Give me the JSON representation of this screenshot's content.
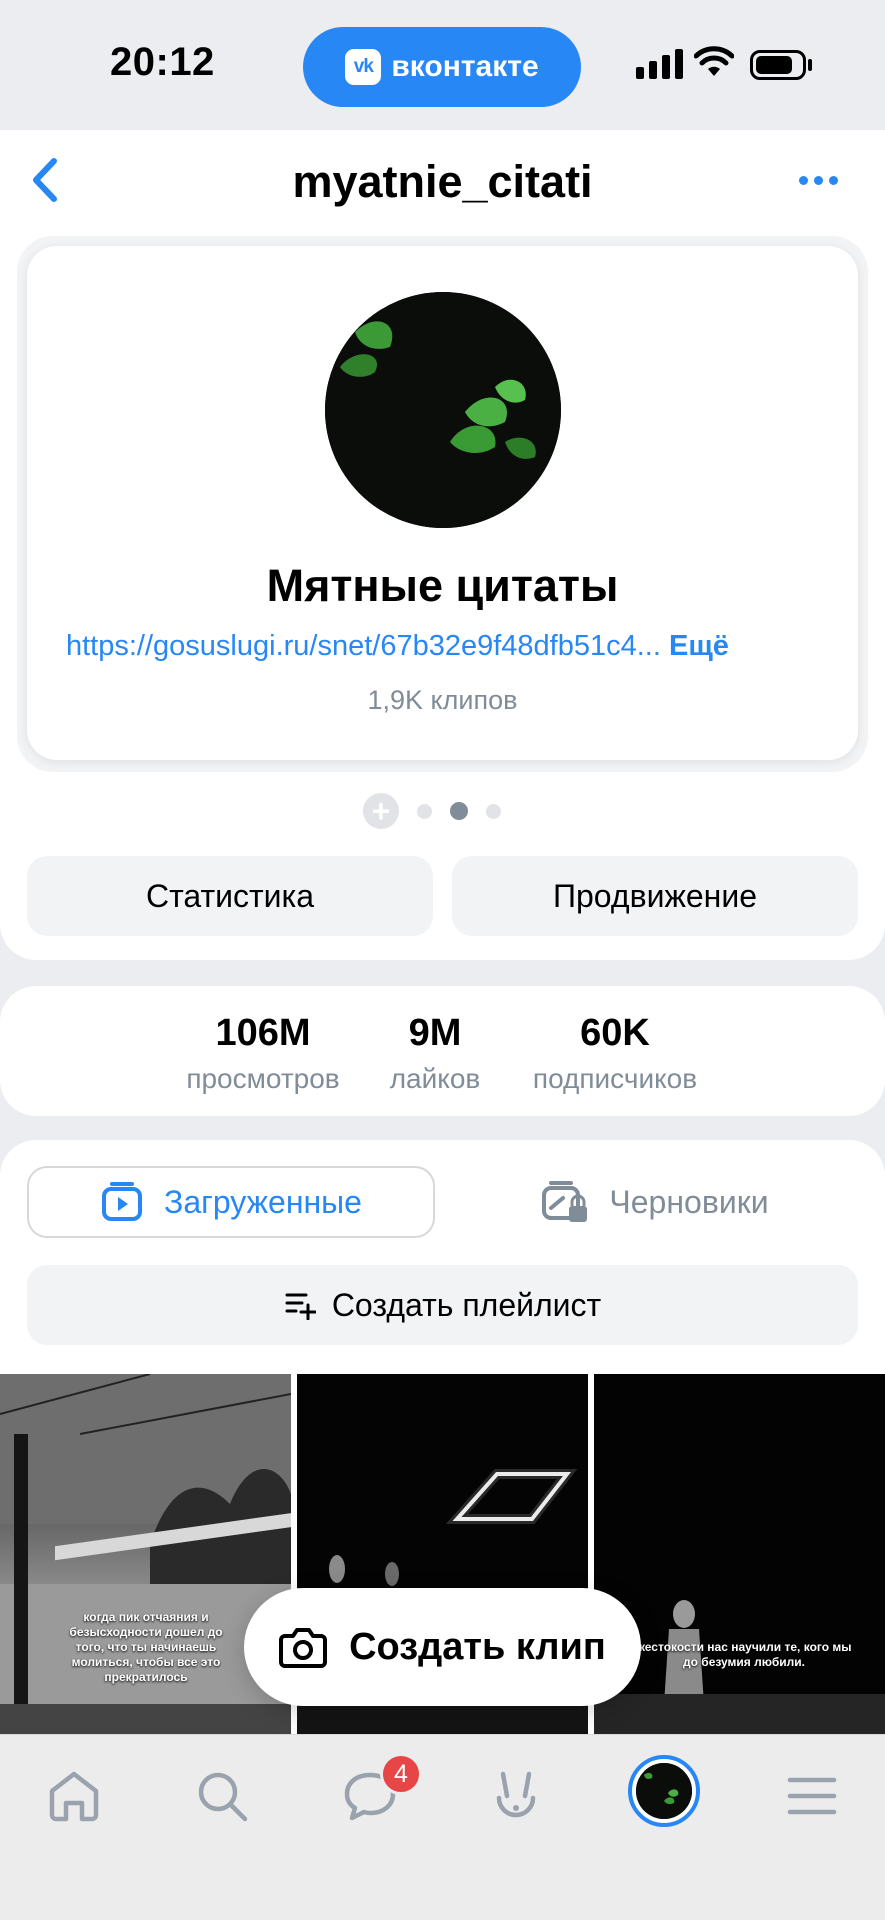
{
  "status_bar": {
    "time": "20:12",
    "app_pill_label": "вконтакте",
    "app_logo_text": "vk"
  },
  "header": {
    "title": "myatnie_citati"
  },
  "profile": {
    "name": "Мятные цитаты",
    "link": "https://gosuslugi.ru/snet/67b32e9f48dfb51c4...",
    "link_more": "Ещё",
    "clips_count": "1,9K клипов",
    "add_symbol": "+"
  },
  "actions": {
    "stats_label": "Статистика",
    "promo_label": "Продвижение"
  },
  "stats": [
    {
      "value": "106M",
      "label": "просмотров"
    },
    {
      "value": "9M",
      "label": "лайков"
    },
    {
      "value": "60K",
      "label": "подписчиков"
    }
  ],
  "tabs": {
    "uploaded_label": "Загруженные",
    "drafts_label": "Черновики"
  },
  "playlist_label": "Создать плейлист",
  "thumbnails": [
    {
      "caption": "когда пик отчаяния и безысходности дошел до того, что ты начинаешь молиться, чтобы все это прекратилось"
    },
    {
      "caption": ""
    },
    {
      "caption": "жестокости нас научили те, кого мы до безумия любили."
    }
  ],
  "create_clip_label": "Создать клип",
  "tabbar": {
    "messages_badge": "4"
  },
  "colors": {
    "accent": "#2787f5",
    "secondary_text": "#818c99",
    "badge": "#e64646",
    "background": "#ebedf0"
  },
  "icons": [
    "back-arrow-icon",
    "more-icon",
    "clip-icon",
    "draft-lock-icon",
    "playlist-add-icon",
    "camera-icon",
    "home-icon",
    "search-icon",
    "messages-icon",
    "clips-bunny-icon",
    "menu-icon"
  ]
}
